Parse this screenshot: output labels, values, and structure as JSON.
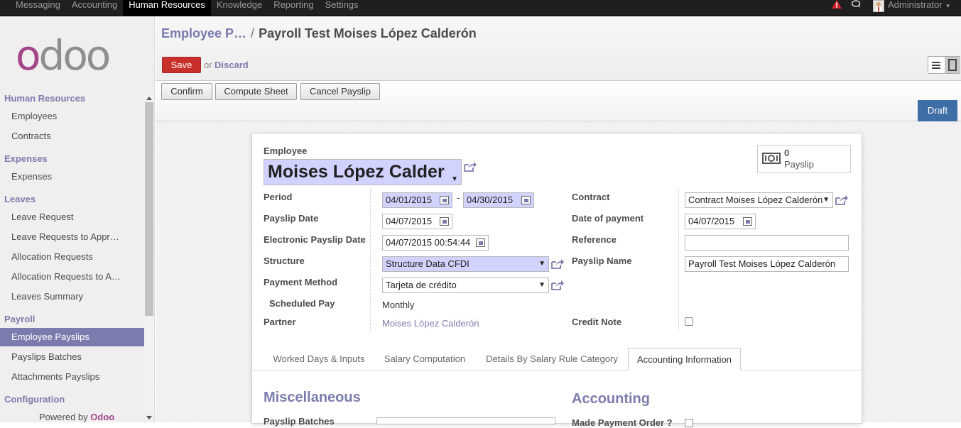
{
  "topnav": {
    "items": [
      "Messaging",
      "Accounting",
      "Human Resources",
      "Knowledge",
      "Reporting",
      "Settings"
    ],
    "active": "Human Resources",
    "user": "Administrator"
  },
  "sidebar": {
    "sections": [
      {
        "title": "Human Resources",
        "items": [
          "Employees",
          "Contracts"
        ]
      },
      {
        "title": "Expenses",
        "items": [
          "Expenses"
        ]
      },
      {
        "title": "Leaves",
        "items": [
          "Leave Request",
          "Leave Requests to Appr…",
          "Allocation Requests",
          "Allocation Requests to A…",
          "Leaves Summary"
        ]
      },
      {
        "title": "Payroll",
        "items": [
          "Employee Payslips",
          "Payslips Batches",
          "Attachments Payslips"
        ]
      },
      {
        "title": "Configuration",
        "items": []
      }
    ],
    "active_item": "Employee Payslips",
    "powered_prefix": "Powered by ",
    "powered_brand": "Odoo",
    "logo_text": "odoo"
  },
  "header": {
    "breadcrumb_parent": "Employee P…",
    "breadcrumb_sep": "/",
    "breadcrumb_current": "Payroll Test Moises López Calderón",
    "save_label": "Save",
    "or_label": "or",
    "discard_label": "Discard"
  },
  "statusbar": {
    "buttons": [
      "Confirm",
      "Compute Sheet",
      "Cancel Payslip"
    ],
    "state": "Draft"
  },
  "form": {
    "employee_label": "Employee",
    "employee_value": "Moises López Calder",
    "smart_button": {
      "count": "0",
      "label": "Payslip"
    },
    "period_label": "Period",
    "period_from": "04/01/2015",
    "period_dash": "-",
    "period_to": "04/30/2015",
    "payslip_date_label": "Payslip Date",
    "payslip_date": "04/07/2015",
    "electronic_date_label": "Electronic Payslip Date",
    "electronic_date": "04/07/2015 00:54:44",
    "structure_label": "Structure",
    "structure_value": "Structure Data CFDI",
    "payment_method_label": "Payment Method",
    "payment_method_value": "Tarjeta de crédito",
    "scheduled_pay_label": "Scheduled Pay",
    "scheduled_pay_value": "Monthly",
    "partner_label": "Partner",
    "partner_value": "Moises López Calderón",
    "contract_label": "Contract",
    "contract_value": "Contract Moises López Calderón",
    "date_payment_label": "Date of payment",
    "date_payment": "04/07/2015",
    "reference_label": "Reference",
    "reference_value": "",
    "payslip_name_label": "Payslip Name",
    "payslip_name_value": "Payroll Test Moises López Calderón",
    "credit_note_label": "Credit Note",
    "credit_note_checked": false
  },
  "tabs": {
    "items": [
      "Worked Days & Inputs",
      "Salary Computation",
      "Details By Salary Rule Category",
      "Accounting Information"
    ],
    "active": "Accounting Information"
  },
  "sections": {
    "misc_title": "Miscellaneous",
    "accounting_title": "Accounting",
    "payslip_batches_label": "Payslip Batches",
    "make_payment_label": "Made Payment Order ?"
  },
  "colors": {
    "brand": "#7c7bad",
    "save": "#c9302c",
    "draft": "#3f6ea6",
    "logo_o": "#a24689",
    "logo_rest": "#8f8f8f"
  }
}
